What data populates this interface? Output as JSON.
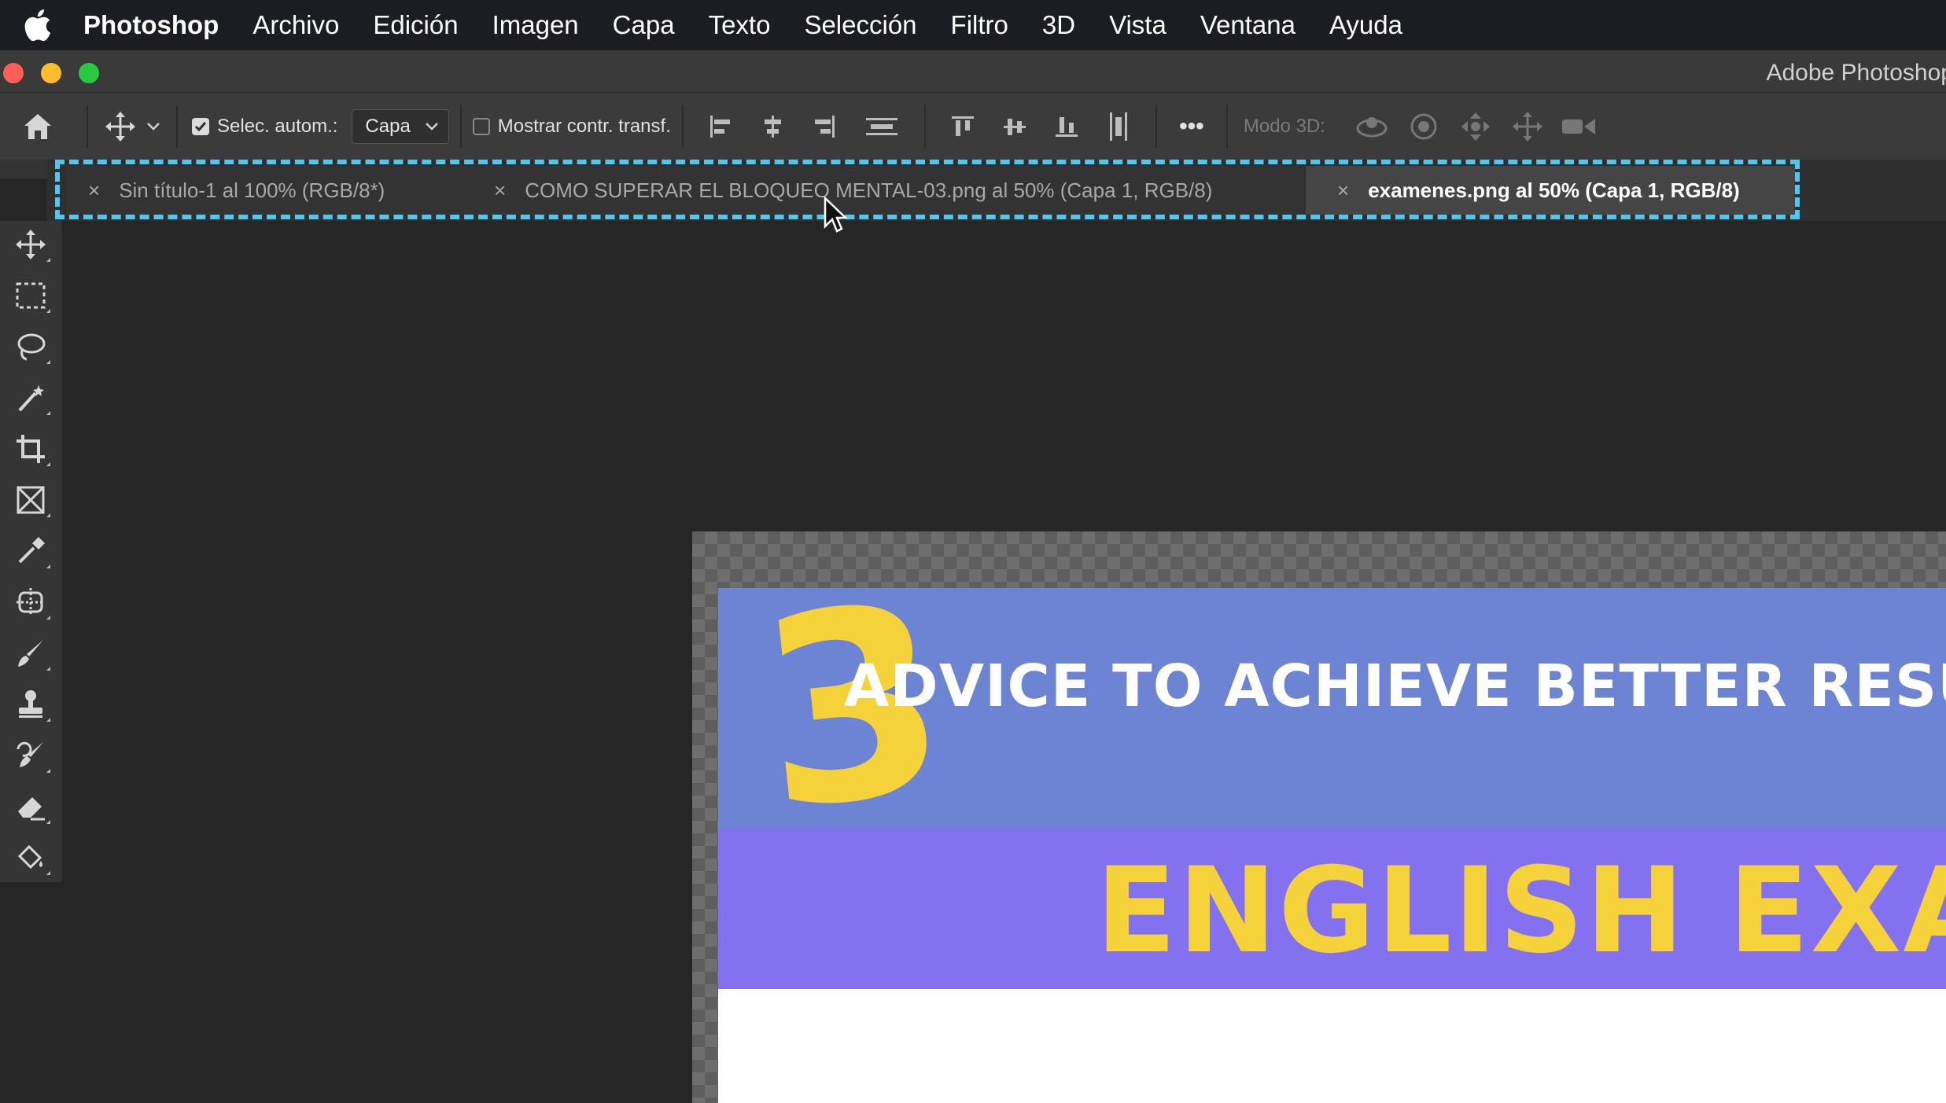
{
  "menubar": {
    "apple_icon": "apple-logo-icon",
    "items": [
      {
        "label": "Photoshop",
        "bold": true
      },
      {
        "label": "Archivo"
      },
      {
        "label": "Edición"
      },
      {
        "label": "Imagen"
      },
      {
        "label": "Capa"
      },
      {
        "label": "Texto"
      },
      {
        "label": "Selección"
      },
      {
        "label": "Filtro"
      },
      {
        "label": "3D"
      },
      {
        "label": "Vista"
      },
      {
        "label": "Ventana"
      },
      {
        "label": "Ayuda"
      }
    ]
  },
  "window": {
    "title": "Adobe Photoshop",
    "traffic_lights": {
      "close": "#fe5f57",
      "minimize": "#febc2e",
      "zoom": "#28c840"
    }
  },
  "options_bar": {
    "auto_select_checked": true,
    "auto_select_label": "Selec. autom.:",
    "auto_select_target": "Capa",
    "show_transform_checked": false,
    "show_transform_label": "Mostrar contr. transf.",
    "more_label": "•••",
    "mode_3d_label": "Modo 3D:"
  },
  "tabs": [
    {
      "label": "Sin título-1 al 100% (RGB/8*)",
      "active": false
    },
    {
      "label": "COMO SUPERAR EL BLOQUEO MENTAL-03.png al 50% (Capa 1, RGB/8)",
      "active": false
    },
    {
      "label": "examenes.png al 50% (Capa 1, RGB/8)",
      "active": true
    }
  ],
  "tab_close_glyph": "×",
  "highlight_color": "#4ec8ee",
  "tools": [
    "move-tool",
    "rectangular-marquee-tool",
    "lasso-tool",
    "magic-wand-tool",
    "crop-tool",
    "frame-tool",
    "eyedropper-tool",
    "spot-healing-tool",
    "brush-tool",
    "clone-stamp-tool",
    "history-brush-tool",
    "eraser-tool",
    "paint-bucket-tool"
  ],
  "canvas": {
    "number": "3",
    "headline": "ADVICE TO ACHIEVE BETTER RESULTS O",
    "subhead": "ENGLISH EXAMS",
    "colors": {
      "blue_band": "#6d83d3",
      "purple_band": "#8471f0",
      "yellow": "#f6d23a",
      "white": "#ffffff"
    }
  }
}
